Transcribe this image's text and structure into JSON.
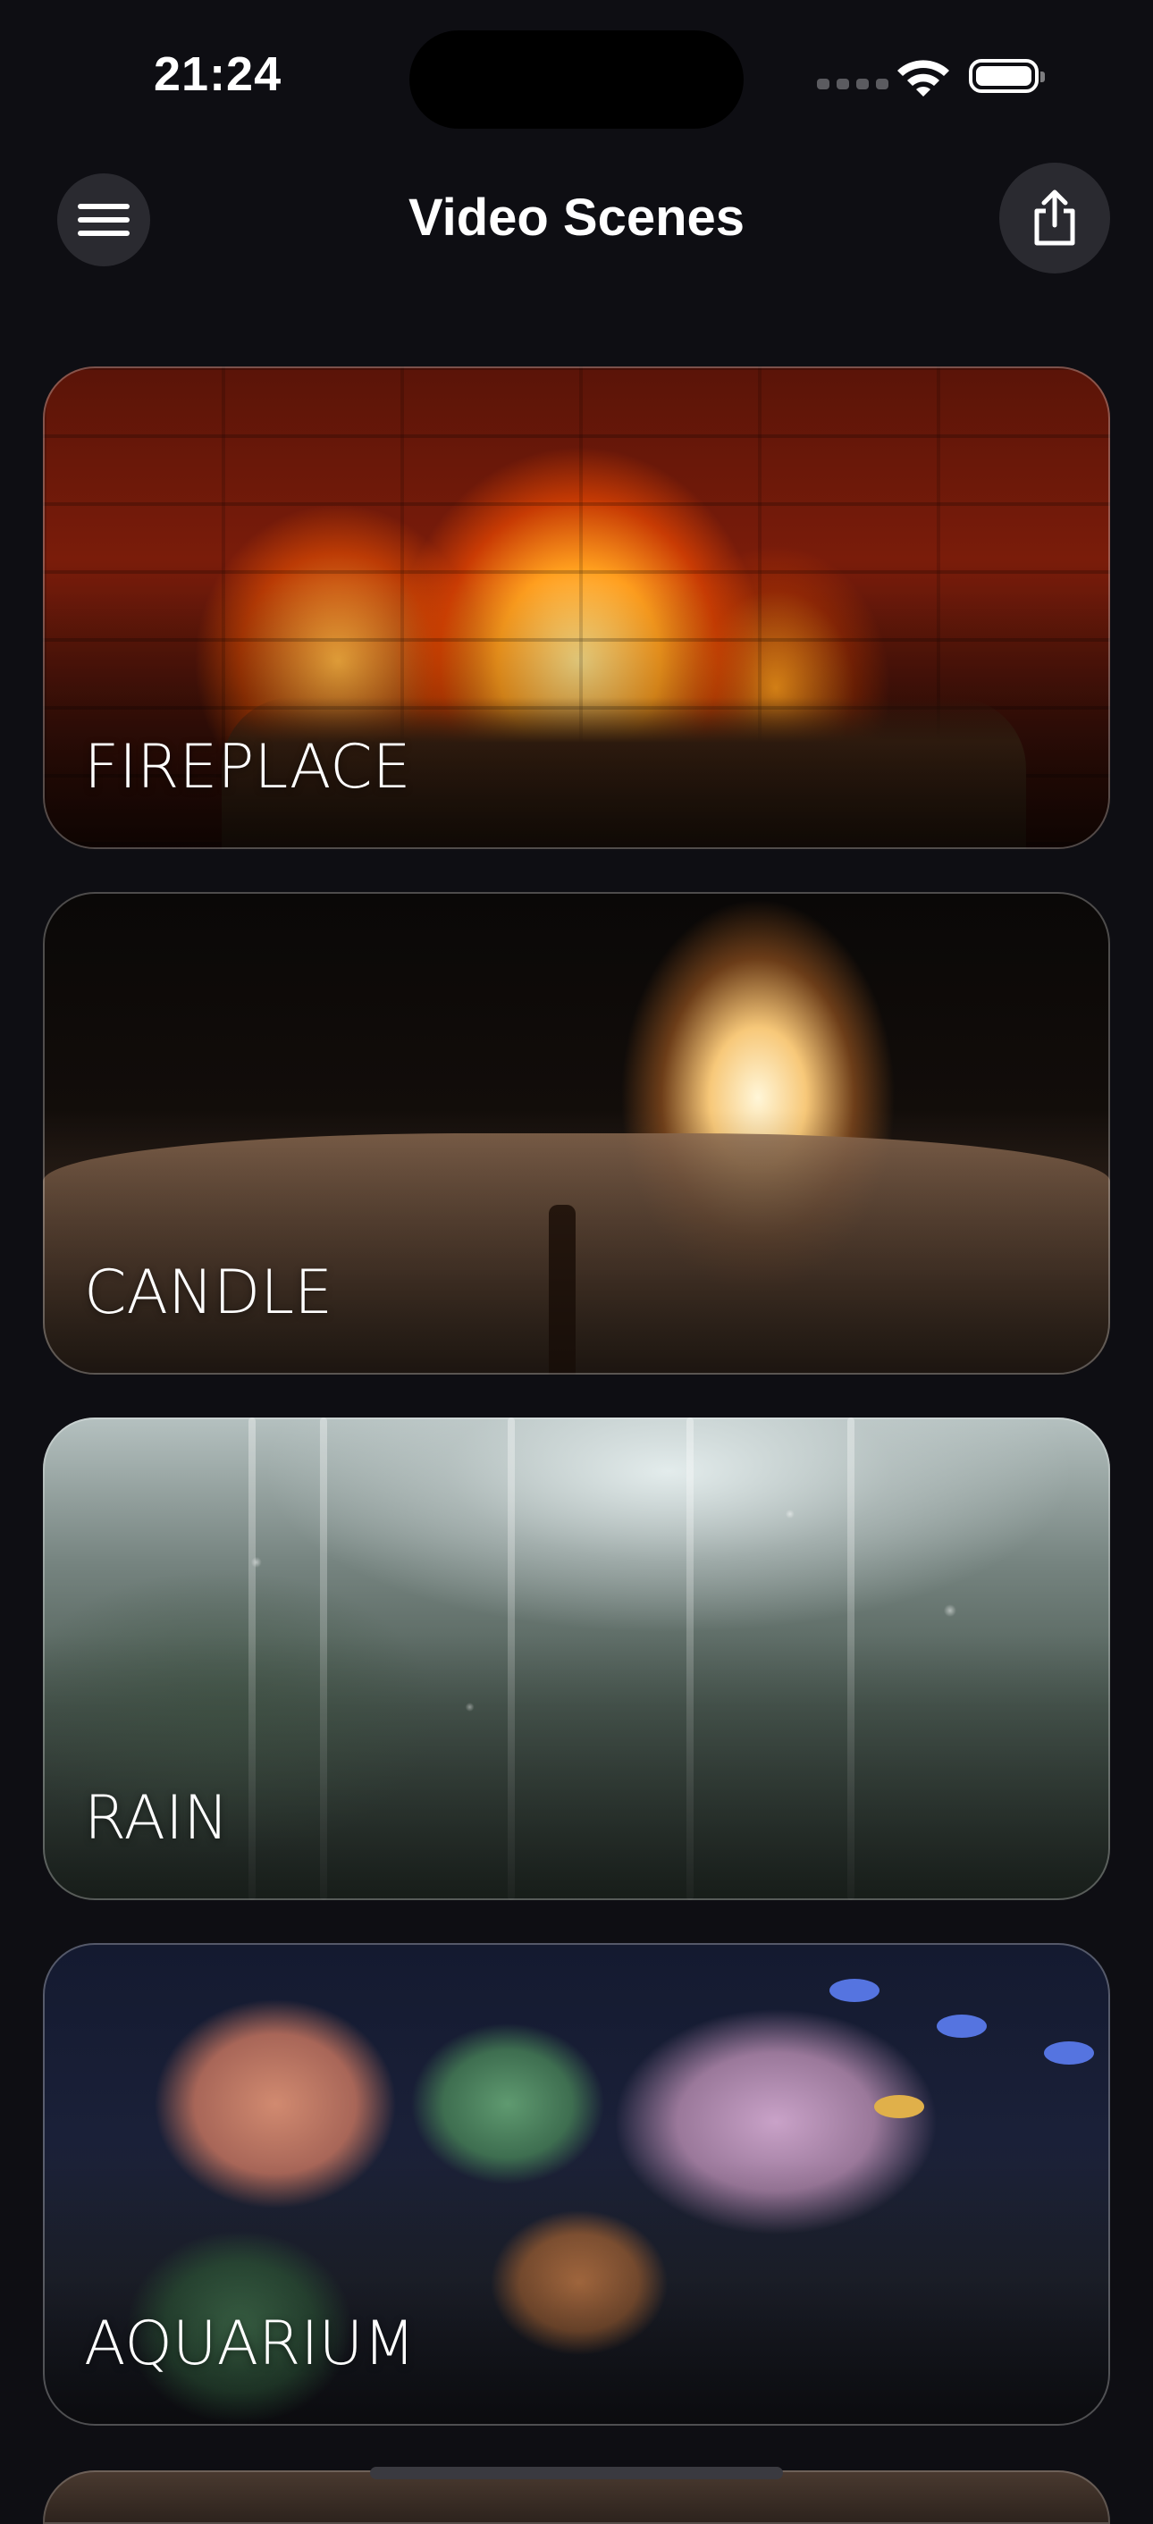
{
  "status_bar": {
    "time": "21:24"
  },
  "header": {
    "title": "Video Scenes"
  },
  "scenes": [
    {
      "label": "FIREPLACE"
    },
    {
      "label": "CANDLE"
    },
    {
      "label": "RAIN"
    },
    {
      "label": "AQUARIUM"
    }
  ],
  "icons": [
    "hamburger-menu-icon",
    "share-icon",
    "wifi-icon",
    "battery-icon",
    "signal-icon"
  ]
}
